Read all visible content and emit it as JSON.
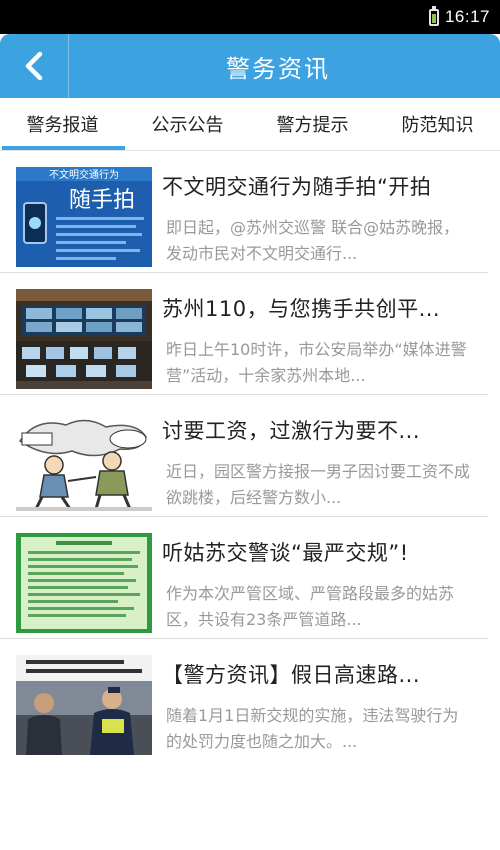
{
  "status_bar": {
    "time": "16:17",
    "battery_icon": "battery-icon"
  },
  "header": {
    "back_icon": "chevron-left-icon",
    "title": "警务资讯",
    "background_color": "#3da2e0"
  },
  "tabs": [
    {
      "label": "警务报道",
      "active": true
    },
    {
      "label": "公示公告",
      "active": false
    },
    {
      "label": "警方提示",
      "active": false
    },
    {
      "label": "防范知识",
      "active": false
    }
  ],
  "news": [
    {
      "title": "不文明交通行为随手拍“开拍",
      "summary": "即日起，@苏州交巡警 联合@姑苏晚报，发动市民对不文明交通行...",
      "thumb_lines": [
        "不文明交通行为",
        "随手拍"
      ]
    },
    {
      "title": "苏州110，与您携手共创平...",
      "summary": "昨日上午10时许，市公安局举办“媒体进警营”活动，十余家苏州本地..."
    },
    {
      "title": "讨要工资，过激行为要不...",
      "summary": "近日，园区警方接报一男子因讨要工资不成欲跳楼，后经警方数小..."
    },
    {
      "title": "听姑苏交警谈“最严交规”!",
      "summary": "作为本次严管区域、严管路段最多的姑苏区，共设有23条严管道路..."
    },
    {
      "title": "【警方资讯】假日高速路...",
      "summary": "随着1月1日新交规的实施，违法驾驶行为的处罚力度也随之加大。..."
    }
  ]
}
